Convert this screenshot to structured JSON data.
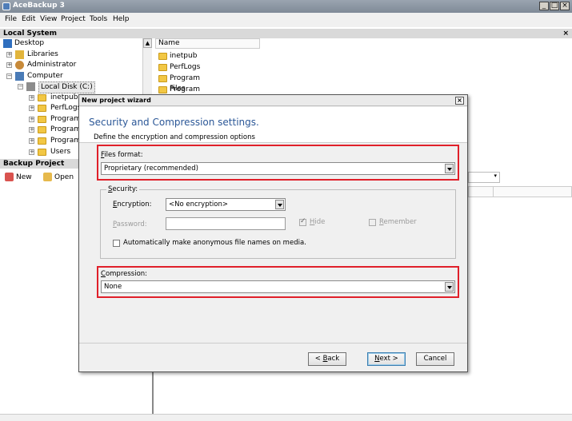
{
  "app": {
    "title": "AceBackup 3"
  },
  "menu": [
    "File",
    "Edit",
    "View",
    "Project",
    "Tools",
    "Help"
  ],
  "local_system": {
    "header": "Local System",
    "close_glyph": "×",
    "tree": [
      {
        "label": "Desktop",
        "icon": "desktop-icon",
        "level": 0,
        "expander": ""
      },
      {
        "label": "Libraries",
        "icon": "libraries-icon",
        "level": 1,
        "expander": "+"
      },
      {
        "label": "Administrator",
        "icon": "user-icon",
        "level": 1,
        "expander": "+"
      },
      {
        "label": "Computer",
        "icon": "computer-icon",
        "level": 1,
        "expander": "−"
      },
      {
        "label": "Local Disk (C:)",
        "icon": "disk-icon",
        "level": 2,
        "expander": "−",
        "selected": true
      },
      {
        "label": "inetpub",
        "icon": "folder-icon",
        "level": 3,
        "expander": "+"
      },
      {
        "label": "PerfLogs",
        "icon": "folder-icon",
        "level": 3,
        "expander": "+"
      },
      {
        "label": "Program",
        "icon": "folder-icon",
        "level": 3,
        "expander": "+"
      },
      {
        "label": "Program",
        "icon": "folder-icon",
        "level": 3,
        "expander": "+"
      },
      {
        "label": "Program",
        "icon": "folder-icon",
        "level": 3,
        "expander": "+"
      },
      {
        "label": "Users",
        "icon": "folder-icon",
        "level": 3,
        "expander": "+"
      }
    ],
    "file_list": {
      "column_name": "Name",
      "items": [
        "inetpub",
        "PerfLogs",
        "Program Files",
        "Program Files (x86)"
      ]
    }
  },
  "backup_project": {
    "header": "Backup Project",
    "toolbar": {
      "new_label": "New",
      "open_label": "Open"
    }
  },
  "dialog": {
    "title": "New project wizard",
    "close_glyph": "×",
    "heading": "Security and Compression settings.",
    "subheading": "Define the encryption and compression options",
    "files_format": {
      "label_accel": "F",
      "label_rest": "iles format:",
      "value": "Proprietary (recommended)"
    },
    "security": {
      "group_accel": "S",
      "group_rest": "ecurity:",
      "encryption_accel": "E",
      "encryption_rest": "ncryption:",
      "encryption_value": "<No encryption>",
      "password_accel": "P",
      "password_rest": "assword:",
      "hide_accel": "H",
      "hide_rest": "ide",
      "remember_accel": "R",
      "remember_rest": "emember",
      "anonymous_label": "Automatically make anonymous file names on media."
    },
    "compression": {
      "label_accel": "C",
      "label_rest": "ompression:",
      "value": "None"
    },
    "buttons": {
      "back_prefix": "< ",
      "back_accel": "B",
      "back_rest": "ack",
      "next_accel": "N",
      "next_rest": "ext >",
      "cancel": "Cancel"
    }
  },
  "colors": {
    "highlight_red": "#e0202a",
    "heading_blue": "#2b5797",
    "folder_yellow": "#f2c744"
  }
}
